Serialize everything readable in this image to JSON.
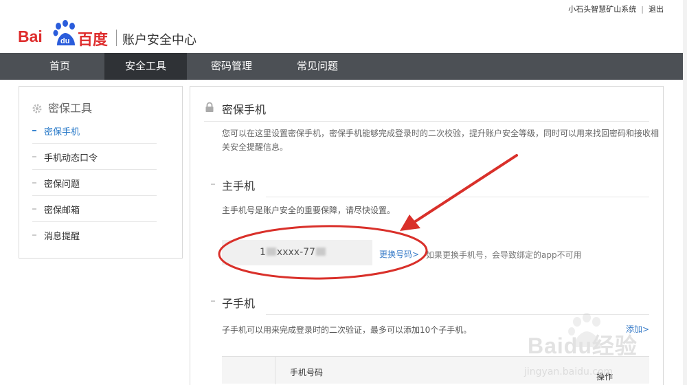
{
  "topbar": {
    "username": "小石头智慧矿山系统",
    "separator": "|",
    "logout": "退出"
  },
  "header": {
    "logo_text_latin": "Bai",
    "logo_text_du": "du",
    "logo_text_cn": "百度",
    "title": "账户安全中心",
    "brand_color": "#de2d2d"
  },
  "nav": {
    "items": [
      {
        "label": "首页"
      },
      {
        "label": "安全工具",
        "active": true
      },
      {
        "label": "密码管理"
      },
      {
        "label": "常见问题"
      }
    ]
  },
  "sidebar": {
    "heading": "密保工具",
    "heading_icon": "gear-icon",
    "items": [
      {
        "label": "密保手机",
        "active": true
      },
      {
        "label": "手机动态口令"
      },
      {
        "label": "密保问题"
      },
      {
        "label": "密保邮箱"
      },
      {
        "label": "消息提醒"
      }
    ]
  },
  "main": {
    "title": "密保手机",
    "title_icon": "lock-icon",
    "description": "您可以在这里设置密保手机，密保手机能够完成登录时的二次校验，提升账户安全等级，同时可以用来找回密码和接收相关安全提醒信息。",
    "primary": {
      "heading": "主手机",
      "note": "主手机号是账户安全的重要保障，请尽快设置。",
      "number_prefix": "1",
      "number_mid": "xxxx-77",
      "change_link": "更换号码>",
      "warning": "如果更换手机号，会导致绑定的app不可用"
    },
    "secondary": {
      "heading": "子手机",
      "note": "子手机可以用来完成登录时的二次验证，最多可以添加10个子手机。",
      "add_link": "添加>",
      "table_headers": [
        "手机号码",
        "操作"
      ]
    }
  },
  "watermark": {
    "text": "jingyan.baidu.com",
    "logo": "Baidu经验"
  },
  "colors": {
    "nav_bg": "#4c5055",
    "nav_active": "#2f3236",
    "link": "#3b7ec9",
    "annotation": "#d9302a"
  }
}
